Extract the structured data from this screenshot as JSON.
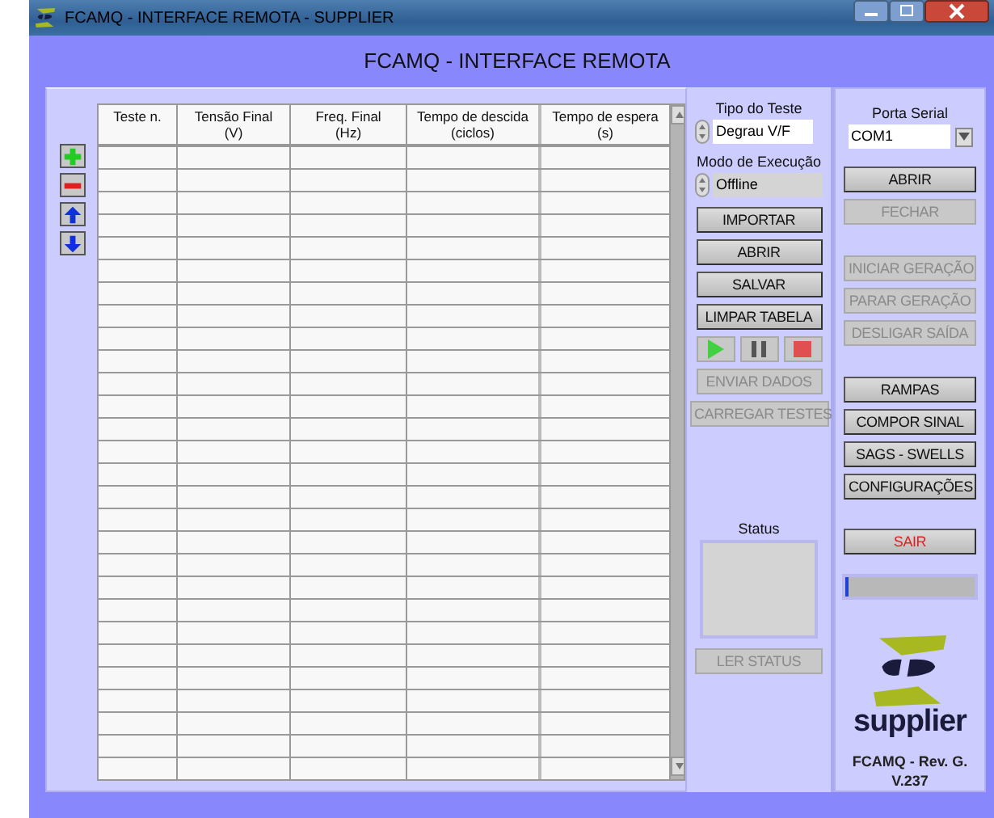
{
  "window": {
    "title": "FCAMQ - INTERFACE REMOTA - SUPPLIER"
  },
  "heading": "FCAMQ - INTERFACE REMOTA",
  "row_tools": [
    {
      "kind": "add"
    },
    {
      "kind": "remove"
    },
    {
      "kind": "up"
    },
    {
      "kind": "down"
    }
  ],
  "table": {
    "columns": [
      {
        "title": "Teste n."
      },
      {
        "title": "Tensão Final",
        "unit": "(V)"
      },
      {
        "title": "Freq. Final",
        "unit": "(Hz)"
      },
      {
        "title": "Tempo de descida",
        "unit": "(ciclos)"
      },
      {
        "title": "Tempo de espera",
        "unit": "(s)"
      }
    ]
  },
  "test_panel": {
    "test_type": {
      "label": "Tipo do Teste",
      "value": "Degrau V/F"
    },
    "execution_mode": {
      "label": "Modo de Execução",
      "value": "Offline"
    },
    "buttons": [
      {
        "label": "IMPORTAR",
        "disabled": false
      },
      {
        "label": "ABRIR",
        "disabled": false
      },
      {
        "label": "SALVAR",
        "disabled": false
      },
      {
        "label": "LIMPAR TABELA",
        "disabled": false
      }
    ],
    "playback": [
      {
        "kind": "play"
      },
      {
        "kind": "pause"
      },
      {
        "kind": "stop"
      }
    ],
    "send_buttons": [
      {
        "label": "ENVIAR DADOS",
        "disabled": true
      },
      {
        "label": "CARREGAR TESTES",
        "disabled": true
      }
    ],
    "status": {
      "label": "Status",
      "button": {
        "label": "LER STATUS",
        "disabled": true
      }
    }
  },
  "serial_panel": {
    "port": {
      "label": "Porta Serial",
      "value": "COM1"
    },
    "port_buttons": [
      {
        "label": "ABRIR",
        "disabled": false
      },
      {
        "label": "FECHAR",
        "disabled": true
      }
    ],
    "generation_buttons": [
      {
        "label": "INICIAR GERAÇÃO",
        "disabled": true
      },
      {
        "label": "PARAR GERAÇÃO",
        "disabled": true
      },
      {
        "label": "DESLIGAR SAÍDA",
        "disabled": true
      }
    ],
    "tool_buttons": [
      {
        "label": "RAMPAS",
        "disabled": false
      },
      {
        "label": "COMPOR SINAL",
        "disabled": false
      },
      {
        "label": "SAGS - SWELLS",
        "disabled": false
      },
      {
        "label": "CONFIGURAÇÕES",
        "disabled": false
      }
    ],
    "exit_button": {
      "label": "SAIR",
      "kind": "danger",
      "disabled": false
    },
    "progress": {
      "level": 0.01
    },
    "brand": "supplier",
    "version": [
      "FCAMQ - Rev. G.",
      "V.237"
    ]
  }
}
